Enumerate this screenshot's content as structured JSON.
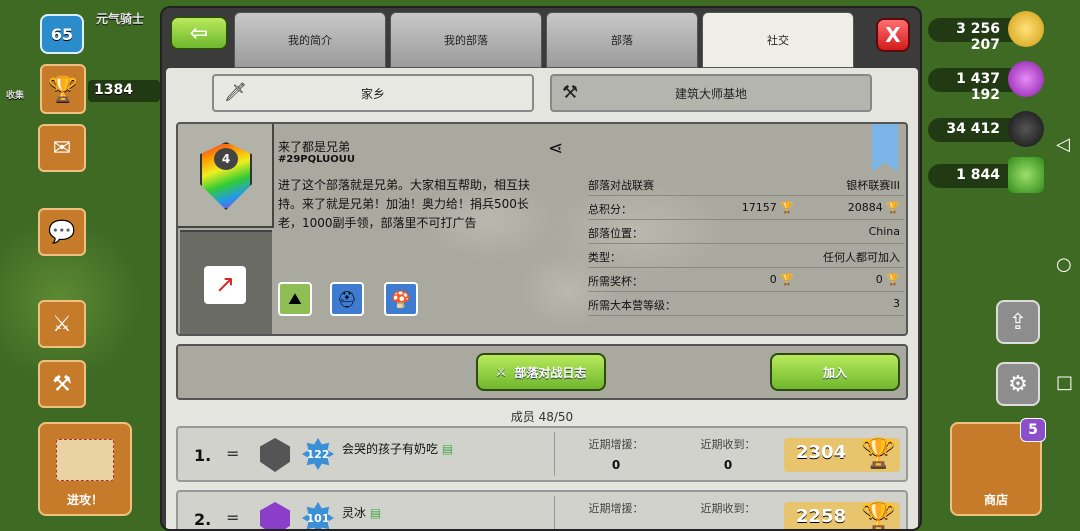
{
  "hud": {
    "level": "65",
    "player_name": "元气骑士",
    "trophies": "1384",
    "attack_label": "进攻！",
    "shop_label": "商店",
    "shop_badge": "5",
    "gold": "3 256 207",
    "elixir": "1 437 192",
    "dark_elixir": "34 412",
    "gems": "1 844",
    "left_edge_text": "收集"
  },
  "tabs": [
    "我的简介",
    "我的部落",
    "部落",
    "社交"
  ],
  "active_tab": "社交",
  "close_label": "X",
  "subtabs": {
    "home": "家乡",
    "builder": "建筑大师基地"
  },
  "clan": {
    "name": "来了都是兄弟",
    "tag": "#29PQLUOUU",
    "level": "4",
    "description": "进了这个部落就是兄弟。大家相互帮助，相互扶持。来了就是兄弟！加油！奥力给！捐兵500长老，1000副手领，部落里不可打广告"
  },
  "stats": [
    {
      "key": "部落对战联赛",
      "value": "银杯联赛III"
    },
    {
      "key": "总积分：",
      "value1": "17157",
      "value": "20884"
    },
    {
      "key": "部落位置：",
      "value": "China"
    },
    {
      "key": "类型：",
      "value": "任何人都可加入"
    },
    {
      "key": "所需奖杯：",
      "value1": "0",
      "value": "0"
    },
    {
      "key": "所需大本营等级：",
      "value": "3"
    }
  ],
  "actions": {
    "war_log": "部落对战日志",
    "join": "加入"
  },
  "members_label": "成员 48/50",
  "members": [
    {
      "rank": "1.",
      "change": "=",
      "xp": "122",
      "name": "会哭的孩子有奶吃",
      "donated_label": "近期增援：",
      "donated": "0",
      "received_label": "近期收到：",
      "received": "0",
      "trophies": "2304"
    },
    {
      "rank": "2.",
      "change": "=",
      "xp": "101",
      "name": "灵冰",
      "donated_label": "近期增援：",
      "donated": "",
      "received_label": "近期收到：",
      "received": "",
      "trophies": "2258"
    }
  ],
  "colors": {
    "accent_green": "#7cc43a",
    "close_red": "#d21c1c",
    "panel_bg": "#e5e5e0"
  }
}
